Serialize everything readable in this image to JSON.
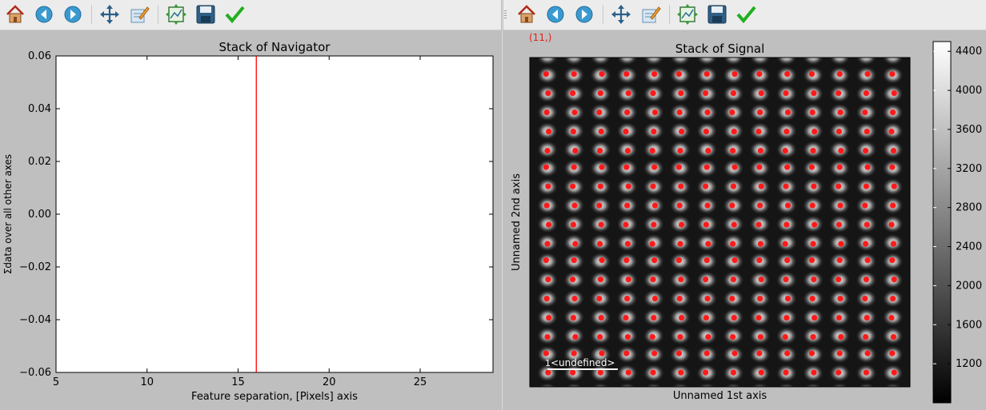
{
  "toolbar": {
    "items": [
      "home-icon",
      "back-icon",
      "forward-icon",
      "pan-icon",
      "configure-icon",
      "edit-axes-icon",
      "save-icon",
      "check-icon"
    ]
  },
  "colors": {
    "cursor_line": "#ff0000",
    "marker": "#ff1a1a",
    "coord_text": "#e0201c"
  },
  "right_window": {
    "coordinate_label": "(11,)"
  },
  "chart_data": [
    {
      "type": "line",
      "title": "Stack of  Navigator",
      "xlabel": "Feature separation, [Pixels] axis",
      "ylabel": "Σdata over all other axes",
      "xlim": [
        5,
        29
      ],
      "ylim": [
        -0.06,
        0.06
      ],
      "xticks": [
        5,
        10,
        15,
        20,
        25
      ],
      "yticks": [
        -0.06,
        -0.04,
        -0.02,
        0.0,
        0.02,
        0.04,
        0.06
      ],
      "xtick_labels": [
        "5",
        "10",
        "15",
        "20",
        "25"
      ],
      "ytick_labels": [
        "−0.06",
        "−0.04",
        "−0.02",
        "0.00",
        "0.02",
        "0.04",
        "0.06"
      ],
      "cursor_x": 16,
      "series": []
    },
    {
      "type": "heatmap",
      "title": "Stack of  Signal",
      "xlabel": "Unnamed 1st axis",
      "ylabel": "Unnamed 2nd axis",
      "colormap": "gray",
      "colorbar": {
        "range": [
          800,
          4500
        ],
        "ticks": [
          1200,
          1600,
          2000,
          2400,
          2800,
          3200,
          3600,
          4000,
          4400
        ],
        "tick_labels": [
          "1200",
          "1600",
          "2000",
          "2400",
          "2800",
          "3200",
          "3600",
          "4000",
          "4400"
        ]
      },
      "lattice": {
        "columns": 14,
        "rows": 17
      },
      "markers": {
        "shape": "circle",
        "color": "red",
        "count": 238
      },
      "scalebar": {
        "value": "1",
        "unit": "<undefined>"
      }
    }
  ]
}
